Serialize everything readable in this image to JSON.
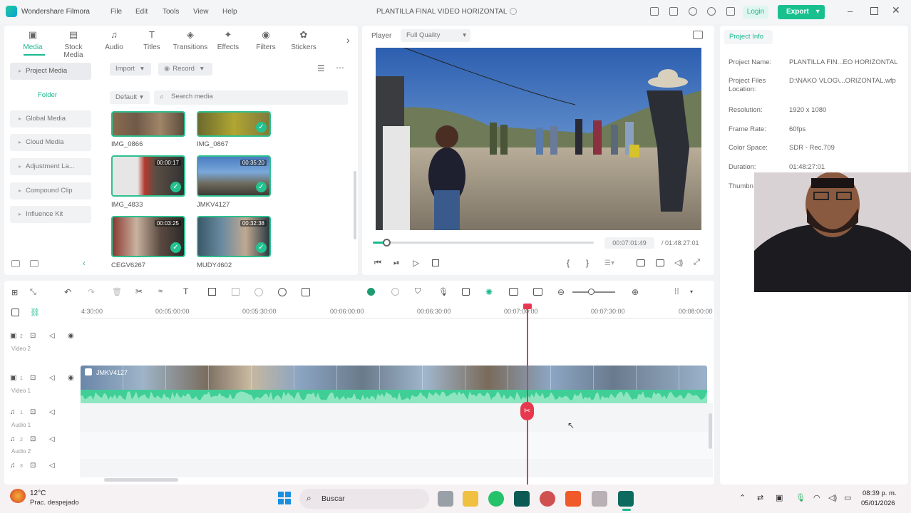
{
  "app": {
    "name": "Wondershare Filmora",
    "project_title": "PLANTILLA FINAL VIDEO HORIZONTAL"
  },
  "menu": [
    "File",
    "Edit",
    "Tools",
    "View",
    "Help"
  ],
  "header": {
    "login_label": "Login",
    "export_label": "Export"
  },
  "media_tabs": [
    {
      "label": "Media",
      "icon": "media-icon"
    },
    {
      "label": "Stock Media",
      "icon": "stock-icon"
    },
    {
      "label": "Audio",
      "icon": "music-icon"
    },
    {
      "label": "Titles",
      "icon": "text-icon"
    },
    {
      "label": "Transitions",
      "icon": "transition-icon"
    },
    {
      "label": "Effects",
      "icon": "effects-icon"
    },
    {
      "label": "Filters",
      "icon": "filters-icon"
    },
    {
      "label": "Stickers",
      "icon": "stickers-icon"
    }
  ],
  "sidebar": {
    "project_media": "Project Media",
    "folder": "Folder",
    "items": [
      "Global Media",
      "Cloud Media",
      "Adjustment La...",
      "Compound Clip",
      "Influence Kit"
    ]
  },
  "media": {
    "import_label": "Import",
    "record_label": "Record",
    "sort_label": "Default",
    "search_placeholder": "Search media",
    "clips": [
      {
        "name": "IMG_0866",
        "duration": ""
      },
      {
        "name": "IMG_0867",
        "duration": ""
      },
      {
        "name": "IMG_4833",
        "duration": "00:00:17"
      },
      {
        "name": "JMKV4127",
        "duration": "00:35:20"
      },
      {
        "name": "CEGV6267",
        "duration": "00:03:25"
      },
      {
        "name": "MUDY4602",
        "duration": "00:32:38"
      }
    ]
  },
  "player": {
    "label": "Player",
    "quality": "Full Quality",
    "current_time": "00:07:01:49",
    "total_time": "/ 01:48:27:01",
    "progress": 0.065
  },
  "project_info": {
    "tab": "Project Info",
    "rows": [
      {
        "label": "Project Name:",
        "value": "PLANTILLA FIN...EO HORIZONTAL"
      },
      {
        "label": "Project Files Location:",
        "value": "D:\\NAKO VLOG\\...ORIZONTAL.wfp"
      },
      {
        "label": "Resolution:",
        "value": "1920 x 1080"
      },
      {
        "label": "Frame Rate:",
        "value": "60fps"
      },
      {
        "label": "Color Space:",
        "value": "SDR - Rec.709"
      },
      {
        "label": "Duration:",
        "value": "01:48:27:01"
      },
      {
        "label": "Thumbn",
        "value": ""
      }
    ]
  },
  "timeline": {
    "ruler": [
      "4:30:00",
      "00:05:00:00",
      "00:05:30:00",
      "00:06:00:00",
      "00:06:30:00",
      "00:07:00:00",
      "00:07:30:00",
      "00:08:00:00"
    ],
    "tracks": [
      {
        "name": "Video 2",
        "number": "2"
      },
      {
        "name": "Video 1",
        "number": "1"
      },
      {
        "name": "Audio 1",
        "number": "1"
      },
      {
        "name": "Audio 2",
        "number": "2"
      },
      {
        "name": "Audio 3",
        "number": "3"
      }
    ],
    "clip_label": "JMKV4127"
  },
  "taskbar": {
    "weather_temp": "12°C",
    "weather_desc": "Prac. despejado",
    "search_label": "Buscar",
    "time": "08:39 p. m.",
    "date": "05/01/2026"
  },
  "colors": {
    "accent": "#19c08f",
    "playhead": "#e8384f",
    "audio_wave": "#3fcf96"
  }
}
